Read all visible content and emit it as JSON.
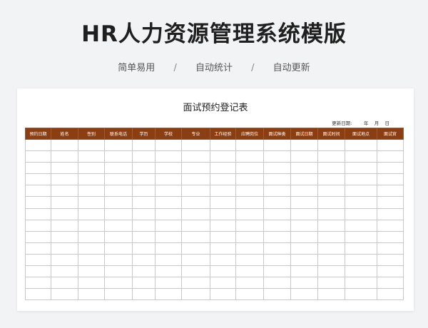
{
  "header": {
    "title": "HR人力资源管理系统模版",
    "features": [
      "简单易用",
      "自动统计",
      "自动更新"
    ],
    "separator": "/"
  },
  "document": {
    "title": "面试预约登记表",
    "update_label": "更新日期:",
    "year_label": "年",
    "month_label": "月",
    "day_label": "日"
  },
  "table": {
    "columns": [
      "预约日期",
      "姓名",
      "性别",
      "联系电话",
      "学历",
      "学校",
      "专业",
      "工作经验",
      "应聘岗位",
      "面试种类",
      "面试日期",
      "面试时间",
      "面试地点",
      "面试官"
    ],
    "row_count": 14,
    "header_color": "#8b3e12"
  }
}
